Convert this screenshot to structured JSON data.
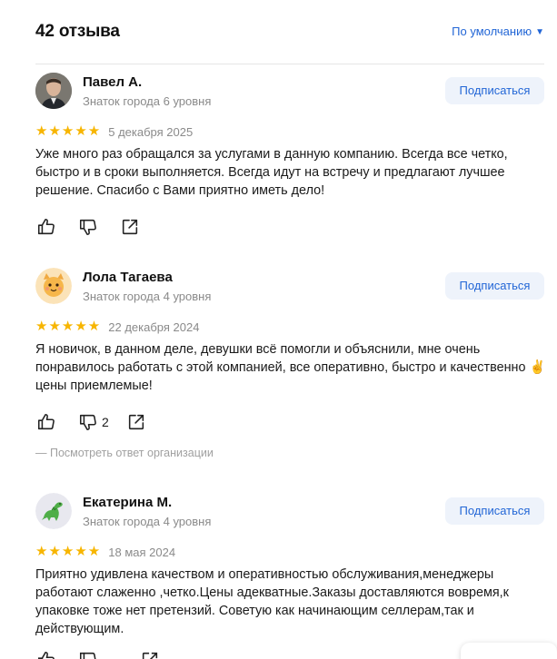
{
  "header": {
    "title": "42 отзыва",
    "sort_label": "По умолчанию",
    "sort_icon": "triangle-down-icon"
  },
  "reviews": [
    {
      "author": "Павел А.",
      "level": "Знаток города 6 уровня",
      "subscribe_label": "Подписаться",
      "rating": 5,
      "stars": "★★★★★",
      "date": "5 декабря 2025",
      "text": "Уже много раз обращался за услугами в данную компанию. Всегда все четко, быстро и в сроки выполняется. Всегда идут на встречу и предлагают лучшее решение. Спасибо с Вами приятно иметь дело!",
      "dislikes": ""
    },
    {
      "author": "Лола Тагаева",
      "level": "Знаток города 4 уровня",
      "subscribe_label": "Подписаться",
      "rating": 5,
      "stars": "★★★★★",
      "date": "22 декабря 2024",
      "text": "Я новичок, в данном деле, девушки всё помогли и объяснили, мне очень понравилось работать с этой компанией, все оперативно, быстро и качественно ✌️ цены приемлемые!",
      "dislikes": "2",
      "org_reply_label": "— Посмотреть ответ организации"
    },
    {
      "author": "Екатерина М.",
      "level": "Знаток города 4 уровня",
      "subscribe_label": "Подписаться",
      "rating": 5,
      "stars": "★★★★★",
      "date": "18 мая 2024",
      "text": "Приятно удивлена качеством и оперативностью обслуживания,менеджеры работают слаженно ,четко.Цены адекватные.Заказы доставляются вовремя,к упаковке тоже нет претензий. Советую как начинающим селлерам,так и действующим.",
      "dislikes": ""
    }
  ],
  "colors": {
    "accent": "#2266d6",
    "star": "#f7b500",
    "muted": "#8a8a8a",
    "button_bg": "#eef3fb"
  }
}
